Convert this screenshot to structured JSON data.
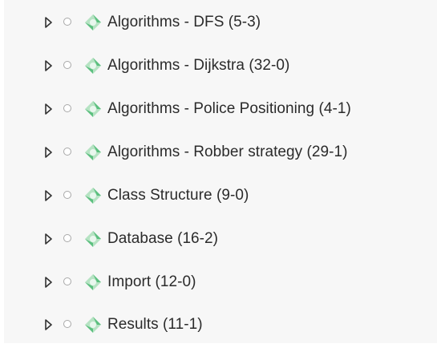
{
  "tree": {
    "items": [
      {
        "label": "Algorithms - DFS (5-3)",
        "expand_icon": "triangle-right-icon",
        "radio_icon": "radio-empty-icon",
        "node_icon": "green-diamond-node-icon"
      },
      {
        "label": "Algorithms - Dijkstra (32-0)",
        "expand_icon": "triangle-right-icon",
        "radio_icon": "radio-empty-icon",
        "node_icon": "green-diamond-node-icon"
      },
      {
        "label": "Algorithms - Police Positioning (4-1)",
        "expand_icon": "triangle-right-icon",
        "radio_icon": "radio-empty-icon",
        "node_icon": "green-diamond-node-icon"
      },
      {
        "label": "Algorithms - Robber strategy (29-1)",
        "expand_icon": "triangle-right-icon",
        "radio_icon": "radio-empty-icon",
        "node_icon": "green-diamond-node-icon"
      },
      {
        "label": "Class Structure (9-0)",
        "expand_icon": "triangle-right-icon",
        "radio_icon": "radio-empty-icon",
        "node_icon": "green-diamond-node-icon"
      },
      {
        "label": "Database (16-2)",
        "expand_icon": "triangle-right-icon",
        "radio_icon": "radio-empty-icon",
        "node_icon": "green-diamond-node-icon"
      },
      {
        "label": "Import (12-0)",
        "expand_icon": "triangle-right-icon",
        "radio_icon": "radio-empty-icon",
        "node_icon": "green-diamond-node-icon"
      },
      {
        "label": "Results (11-1)",
        "expand_icon": "triangle-right-icon",
        "radio_icon": "radio-empty-icon",
        "node_icon": "green-diamond-node-icon"
      }
    ]
  },
  "colors": {
    "panel_background": "#f7f7f7",
    "text": "#2b2b2b",
    "icon_green_light": "#b6e3c3",
    "icon_green_dark": "#5cbf7f",
    "expander": "#333333",
    "radio_border": "#a8a8a8"
  }
}
